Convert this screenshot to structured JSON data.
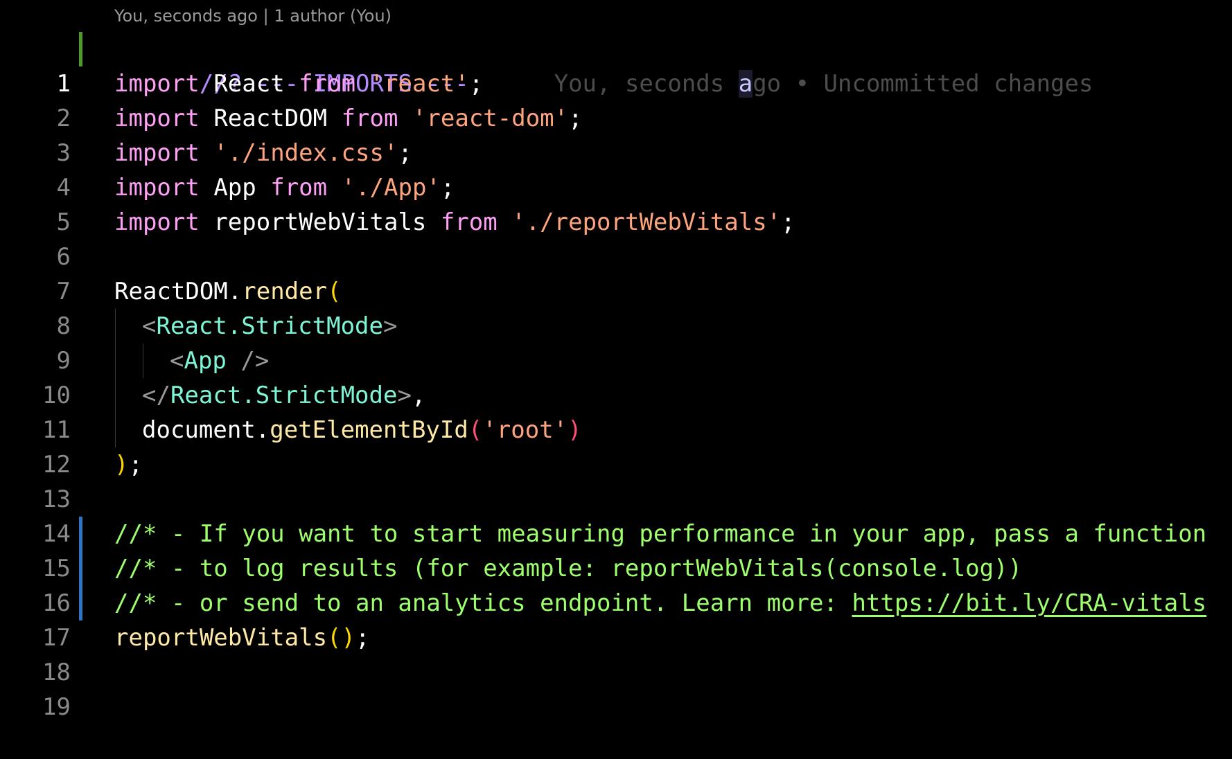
{
  "codelens": {
    "text": "You, seconds ago | 1 author (You)"
  },
  "blame": {
    "before": "You, seconds ",
    "cursor_char": "a",
    "after": "go • Uncommitted changes"
  },
  "lines": {
    "l1": {
      "num": "1",
      "t1": "//? --- IMPORTS ---"
    },
    "l2": {
      "num": "2",
      "t1": "import",
      "t2": "React",
      "t3": "from",
      "t4": "'react'",
      "t5": ";"
    },
    "l3": {
      "num": "3",
      "t1": "import",
      "t2": "ReactDOM",
      "t3": "from",
      "t4": "'react-dom'",
      "t5": ";"
    },
    "l4": {
      "num": "4",
      "t1": "import",
      "t2": "'./index.css'",
      "t3": ";"
    },
    "l5": {
      "num": "5",
      "t1": "import",
      "t2": "App",
      "t3": "from",
      "t4": "'./App'",
      "t5": ";"
    },
    "l6": {
      "num": "6",
      "t1": "import",
      "t2": "reportWebVitals",
      "t3": "from",
      "t4": "'./reportWebVitals'",
      "t5": ";"
    },
    "l7": {
      "num": "7"
    },
    "l8": {
      "num": "8",
      "t1": "ReactDOM",
      "t2": ".",
      "t3": "render",
      "t4": "("
    },
    "l9": {
      "num": "9",
      "t1": "<",
      "t2": "React.StrictMode",
      "t3": ">"
    },
    "l10": {
      "num": "10",
      "t1": "<",
      "t2": "App",
      "t3": " />"
    },
    "l11": {
      "num": "11",
      "t1": "</",
      "t2": "React.StrictMode",
      "t3": ">",
      "t4": ","
    },
    "l12": {
      "num": "12",
      "t1": "document",
      "t2": ".",
      "t3": "getElementById",
      "t4": "(",
      "t5": "'root'",
      "t6": ")"
    },
    "l13": {
      "num": "13",
      "t1": ")",
      "t2": ";"
    },
    "l14": {
      "num": "14"
    },
    "l15": {
      "num": "15",
      "t1": "//* - If you want to start measuring performance in your app, pass a function"
    },
    "l16": {
      "num": "16",
      "t1": "//* - to log results (for example: reportWebVitals(console.log))"
    },
    "l17": {
      "num": "17",
      "t1": "//* - or send to an analytics endpoint. Learn more: ",
      "link": "https://bit.ly/CRA-vitals"
    },
    "l18": {
      "num": "18",
      "t1": "reportWebVitals",
      "t2": "()",
      "t3": ";"
    },
    "l19": {
      "num": "19"
    }
  },
  "colors": {
    "background": "#000000",
    "added_gutter": "#4e9a2a",
    "modified_gutter": "#2f74c0",
    "keyword": "#ff9ff5",
    "string": "#ffa57e",
    "comment_green": "#9eff6e",
    "comment_purple": "#b48cff",
    "jsx_tag": "#7ff5d8"
  }
}
